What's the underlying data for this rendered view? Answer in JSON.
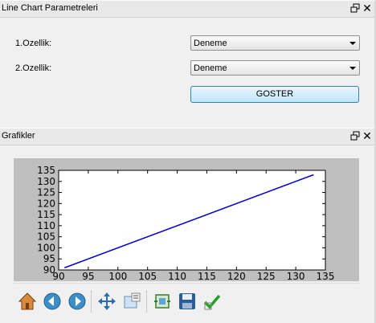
{
  "params_panel": {
    "title": "Line Chart Parametreleri",
    "feature1_label": "1.Ozellik:",
    "feature1_value": "Deneme",
    "feature2_label": "2.Ozellik:",
    "feature2_value": "Deneme",
    "show_button": "GOSTER"
  },
  "charts_panel": {
    "title": "Grafikler"
  },
  "toolbar": {
    "icons": [
      "home-icon",
      "back-icon",
      "forward-icon",
      "pan-icon",
      "configure-subplots-icon",
      "zoom-rect-icon",
      "save-icon",
      "check-icon"
    ]
  },
  "chart_data": {
    "type": "line",
    "title": "",
    "xlabel": "",
    "ylabel": "",
    "xlim": [
      90,
      135
    ],
    "ylim": [
      90,
      135
    ],
    "x_ticks": [
      "90",
      "95",
      "100",
      "105",
      "110",
      "115",
      "120",
      "125",
      "130",
      "135"
    ],
    "y_ticks": [
      "90",
      "95",
      "100",
      "105",
      "110",
      "115",
      "120",
      "125",
      "130",
      "135"
    ],
    "series": [
      {
        "color": "#0000cc",
        "x": [
          91,
          133
        ],
        "y": [
          91,
          133
        ]
      }
    ],
    "grid": false
  }
}
